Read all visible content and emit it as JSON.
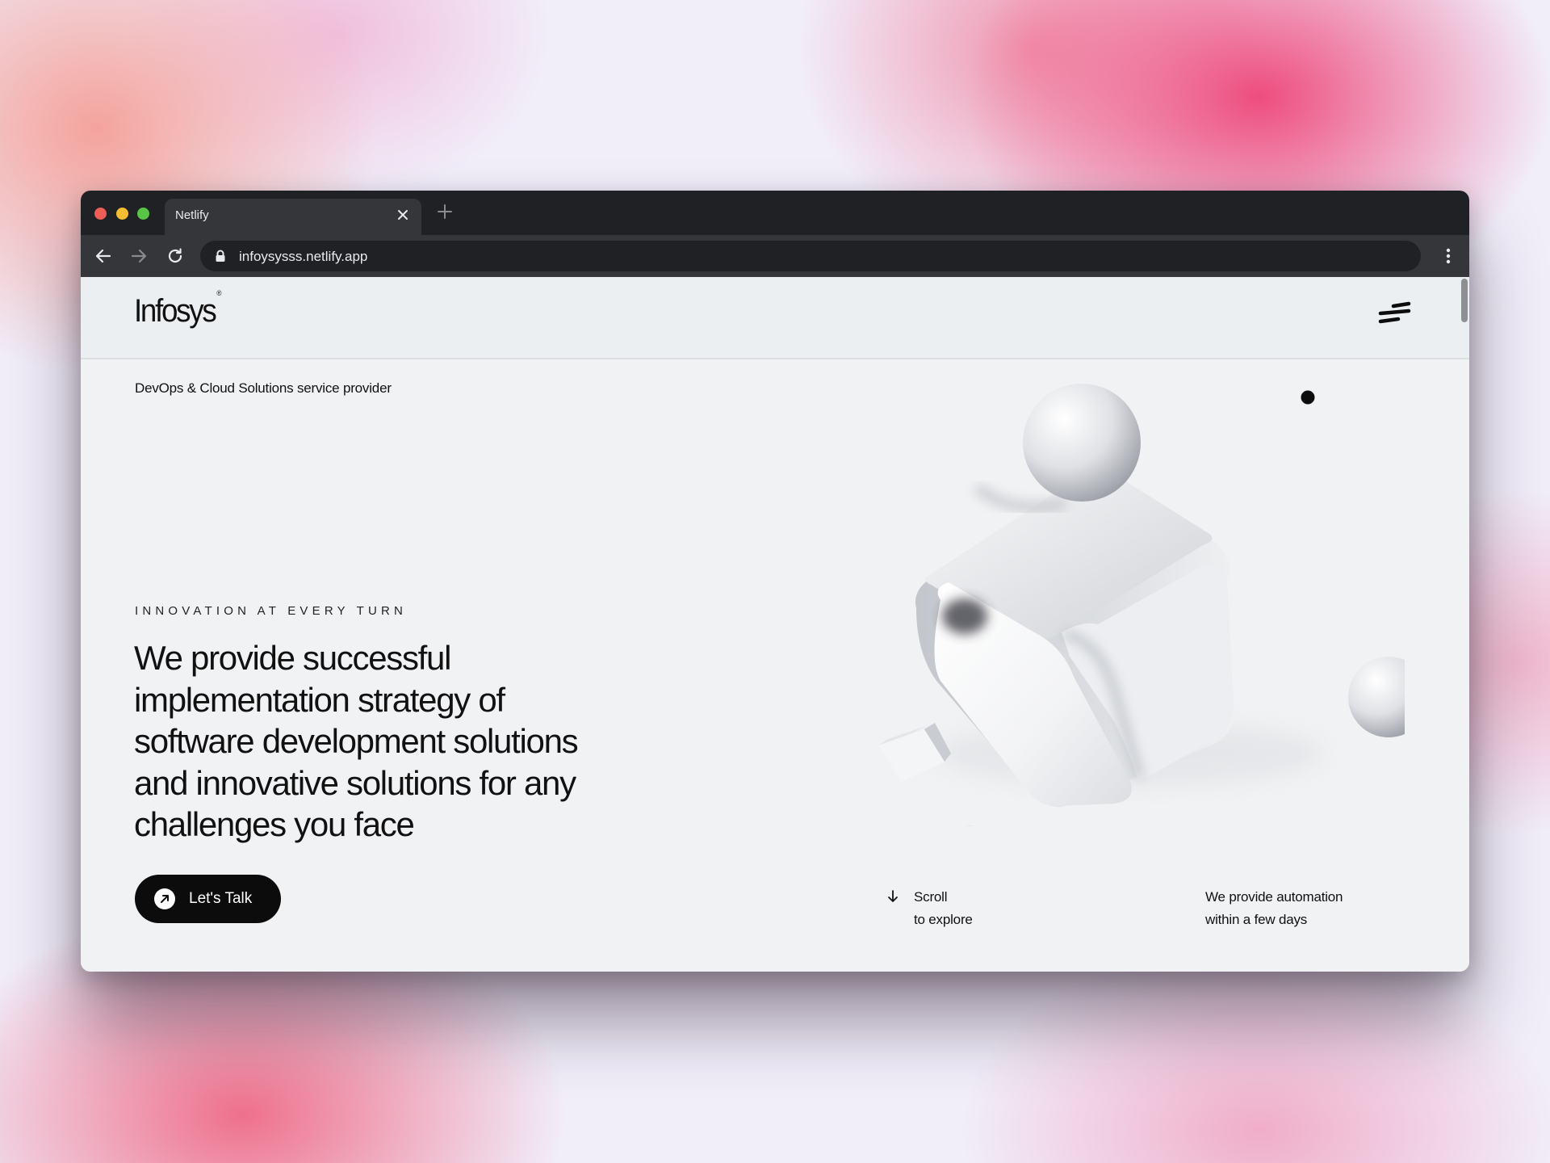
{
  "browser": {
    "tab_title": "Netlify",
    "tab_close_icon": "close-icon",
    "new_tab_icon": "plus-icon",
    "url": "infoysysss.netlify.app",
    "icons": [
      "back-arrow-icon",
      "forward-arrow-icon",
      "reload-icon",
      "lock-icon",
      "more-vert-icon"
    ]
  },
  "site": {
    "logo": "Infosys",
    "logo_mark": "®",
    "menu_icon": "menu-icon",
    "tagline": "DevOps & Cloud Solutions service provider",
    "eyebrow": "INNOVATION AT EVERY TURN",
    "headline": [
      "We provide successful",
      "implementation strategy of",
      "software development solutions",
      "and innovative solutions for any",
      "challenges you face"
    ],
    "cta_label": "Let's Talk",
    "cta_icon": "arrow-up-right-icon",
    "scroll_hint": [
      "Scroll",
      "to explore"
    ],
    "scroll_icon": "arrow-down-icon",
    "automation_note": [
      "We provide automation",
      "within a few days"
    ]
  },
  "colors": {
    "browser_chrome": "#202124",
    "toolbar": "#35363a",
    "page_bg": "#f1f2f4",
    "text": "#111111",
    "cta_bg": "#0c0c0c"
  }
}
